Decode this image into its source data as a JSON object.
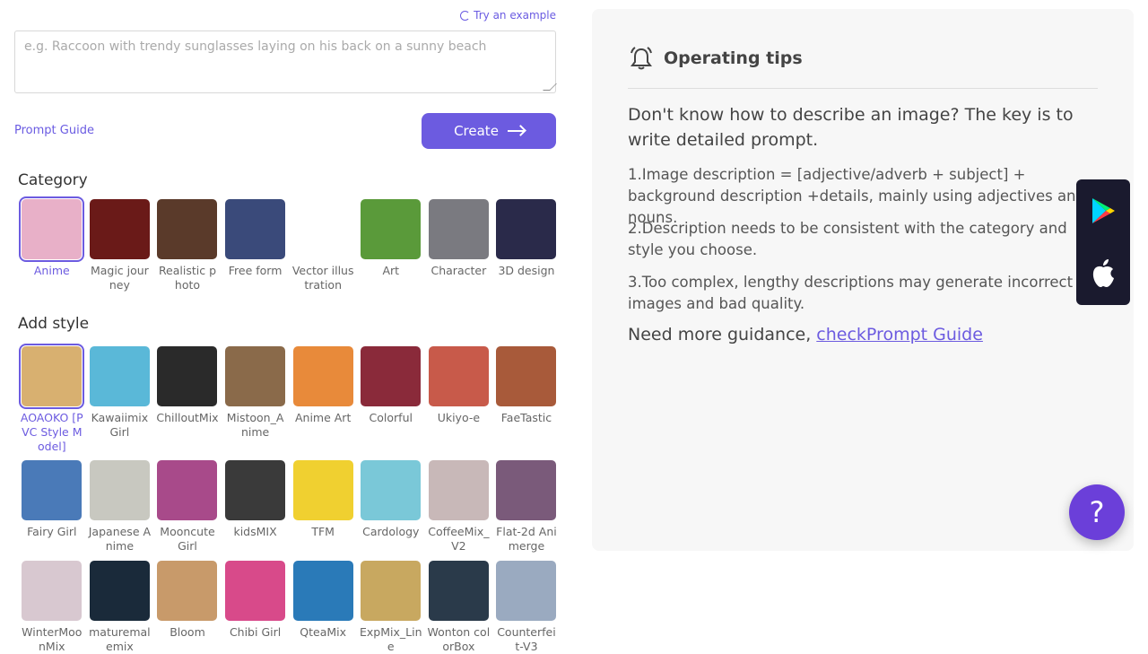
{
  "try_example": "Try an example",
  "prompt_placeholder": "e.g. Raccoon with trendy sunglasses laying on his back on a sunny beach",
  "prompt_guide": "Prompt Guide",
  "create_label": "Create",
  "category_title": "Category",
  "categories": [
    {
      "label": "Anime",
      "color": "#e8b0c8",
      "selected": true
    },
    {
      "label": "Magic journey",
      "color": "#6a1a18"
    },
    {
      "label": "Realistic photo",
      "color": "#5a3a2a"
    },
    {
      "label": "Free form",
      "color": "#3a4a7a"
    },
    {
      "label": "Vector illustration",
      "color": "#ffffff"
    },
    {
      "label": "Art",
      "color": "#5a9a3a"
    },
    {
      "label": "Character",
      "color": "#7a7a80"
    },
    {
      "label": "3D design",
      "color": "#2a2a4a"
    }
  ],
  "style_title": "Add style",
  "styles": [
    [
      {
        "label": "AOAOKO [PVC Style Model]",
        "color": "#d8b070",
        "selected": true
      },
      {
        "label": "Kawaiimix Girl",
        "color": "#5ab8d8"
      },
      {
        "label": "ChilloutMix",
        "color": "#2a2a2a"
      },
      {
        "label": "Mistoon_Anime",
        "color": "#8a6a4a"
      },
      {
        "label": "Anime Art",
        "color": "#e88a3a"
      },
      {
        "label": "Colorful",
        "color": "#8a2a3a"
      },
      {
        "label": "Ukiyo-e",
        "color": "#c85a4a"
      },
      {
        "label": "FaeTastic",
        "color": "#a85a3a"
      }
    ],
    [
      {
        "label": "Fairy Girl",
        "color": "#4a7ab8"
      },
      {
        "label": "Japanese Anime",
        "color": "#c8c8c0"
      },
      {
        "label": "Mooncute Girl",
        "color": "#a84a8a"
      },
      {
        "label": "kidsMIX",
        "color": "#3a3a3a"
      },
      {
        "label": "TFM",
        "color": "#f0d030"
      },
      {
        "label": "Cardology",
        "color": "#7ac8d8"
      },
      {
        "label": "CoffeeMix_V2",
        "color": "#c8b8b8"
      },
      {
        "label": "Flat-2d Animerge",
        "color": "#7a5a7a"
      }
    ],
    [
      {
        "label": "WinterMoonMix",
        "color": "#d8c8d0"
      },
      {
        "label": "maturemalemix",
        "color": "#1a2a3a"
      },
      {
        "label": "Bloom",
        "color": "#c89a6a"
      },
      {
        "label": "Chibi Girl",
        "color": "#d84a8a"
      },
      {
        "label": "QteaMix",
        "color": "#2a7ab8"
      },
      {
        "label": "ExpMix_Line",
        "color": "#c8a860"
      },
      {
        "label": "Wonton colorBox",
        "color": "#2a3a4a"
      },
      {
        "label": "Counterfeit-V3",
        "color": "#9aaac0"
      }
    ]
  ],
  "tips": {
    "title": "Operating tips",
    "intro": "Don't know how to describe an image? The key is to write detailed prompt.",
    "items": [
      "1.Image description = [adjective/adverb + subject] + background description +details, mainly using adjectives and nouns.",
      "2.Description needs to be consistent with the category and style you choose.",
      "3.Too complex, lengthy descriptions may generate incorrect images and bad quality."
    ],
    "more_text": "Need more guidance, ",
    "more_link": "checkPrompt Guide"
  },
  "help_label": "?"
}
